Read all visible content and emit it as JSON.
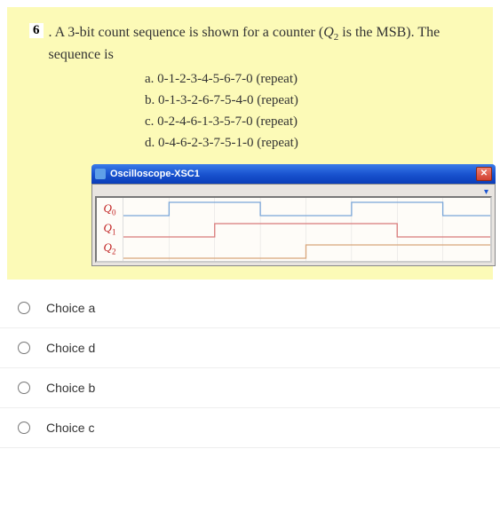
{
  "question": {
    "number": "6",
    "text_prefix": ". A 3-bit count sequence is shown for a counter (",
    "var": "Q",
    "sub": "2",
    "text_middle": " is the MSB). The sequence is",
    "options": {
      "a": "a. 0-1-2-3-4-5-6-7-0 (repeat)",
      "b": "b. 0-1-3-2-6-7-5-4-0 (repeat)",
      "c": "c. 0-2-4-6-1-3-5-7-0 (repeat)",
      "d": "d. 0-4-6-2-3-7-5-1-0 (repeat)"
    }
  },
  "oscilloscope": {
    "title": "Oscilloscope-XSC1",
    "labels": {
      "q0": "Q",
      "q0s": "0",
      "q1": "Q",
      "q1s": "1",
      "q2": "Q",
      "q2s": "2"
    }
  },
  "chart_data": {
    "type": "timing",
    "series": [
      {
        "name": "Q0",
        "pattern": [
          0,
          1,
          1,
          0,
          0,
          1,
          1,
          0,
          0
        ]
      },
      {
        "name": "Q1",
        "pattern": [
          0,
          0,
          1,
          1,
          1,
          1,
          0,
          0,
          0
        ]
      },
      {
        "name": "Q2",
        "pattern": [
          0,
          0,
          0,
          0,
          1,
          1,
          1,
          1,
          0
        ]
      }
    ],
    "colors": {
      "Q0": "#7aa5d8",
      "Q1": "#d87a7a",
      "Q2": "#d8a57a"
    }
  },
  "choices": {
    "a": "Choice a",
    "d": "Choice d",
    "b": "Choice b",
    "c": "Choice c"
  }
}
